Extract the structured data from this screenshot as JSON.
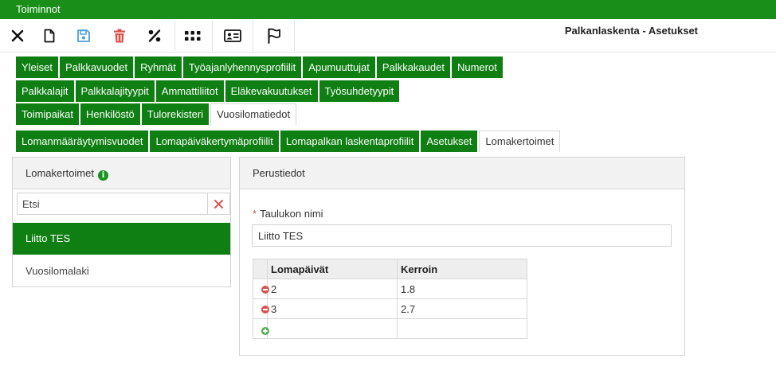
{
  "topbar": {
    "title": "Toiminnot"
  },
  "toolbar": {
    "page_title": "Palkanlaskenta - Asetukset",
    "buttons": [
      {
        "name": "close",
        "icon": "close-icon"
      },
      {
        "name": "new",
        "icon": "new-document-icon"
      },
      {
        "name": "save",
        "icon": "save-icon"
      },
      {
        "name": "delete",
        "icon": "trash-icon"
      },
      {
        "name": "percent",
        "icon": "percent-icon"
      },
      {
        "name": "apps",
        "icon": "grid-icon"
      },
      {
        "name": "card",
        "icon": "id-card-icon"
      },
      {
        "name": "flag",
        "icon": "flag-icon"
      }
    ]
  },
  "tabs": {
    "row1": [
      "Yleiset",
      "Palkkavuodet",
      "Ryhmät",
      "Työajanlyhennysprofiilit",
      "Apumuuttujat",
      "Palkkakaudet",
      "Numerot"
    ],
    "row2": [
      "Palkkalajit",
      "Palkkalajityypit",
      "Ammattiliitot",
      "Eläkevakuutukset",
      "Työsuhdetyypit"
    ],
    "row3": [
      "Toimipaikat",
      "Henkilöstö",
      "Tulorekisteri",
      "Vuosilomatiedot"
    ],
    "row4": [
      "Lomanmääräytymisvuodet",
      "Lomapäiväkertymäprofiilit",
      "Lomapalkan laskentaprofiilit",
      "Asetukset",
      "Lomakertoimet"
    ],
    "active_row3": "Vuosilomatiedot",
    "active_row4": "Lomakertoimet"
  },
  "left_panel": {
    "title": "Lomakertoimet",
    "info_icon": "info-icon",
    "search": {
      "placeholder": "Etsi",
      "value": ""
    },
    "items": [
      "Liitto TES",
      "Vuosilomalaki"
    ],
    "selected": "Liitto TES"
  },
  "right_panel": {
    "title": "Perustiedot",
    "field_label": "Taulukon nimi",
    "field_value": "Liitto TES",
    "table": {
      "columns": [
        "Lomapäivät",
        "Kerroin"
      ],
      "rows": [
        [
          "2",
          "1.8"
        ],
        [
          "3",
          "2.7"
        ]
      ]
    }
  },
  "colors": {
    "topbar": "#198f19",
    "tab_green": "#0f7f13",
    "selected_item": "#0f7f13",
    "save_icon": "#4a9fd8",
    "delete_icon": "#d9534f"
  }
}
